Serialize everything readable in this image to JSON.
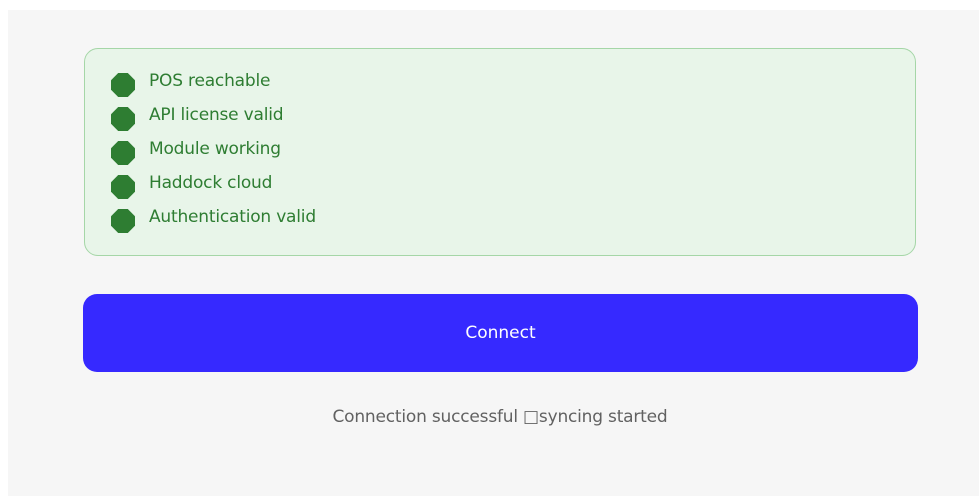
{
  "status_panel": {
    "items": [
      {
        "label": "POS reachable",
        "icon": "status-ok-icon"
      },
      {
        "label": "API license valid",
        "icon": "status-ok-icon"
      },
      {
        "label": "Module working",
        "icon": "status-ok-icon"
      },
      {
        "label": "Haddock cloud",
        "icon": "status-ok-icon"
      },
      {
        "label": "Authentication valid",
        "icon": "status-ok-icon"
      }
    ]
  },
  "actions": {
    "connect_label": "Connect"
  },
  "status_message": "Connection successful □syncing started",
  "colors": {
    "page_background": "#f6f6f6",
    "panel_background": "#e8f5e9",
    "panel_border": "#a5d6a7",
    "success_green": "#2e7d32",
    "primary_button": "#3629ff",
    "message_text": "#616161"
  }
}
